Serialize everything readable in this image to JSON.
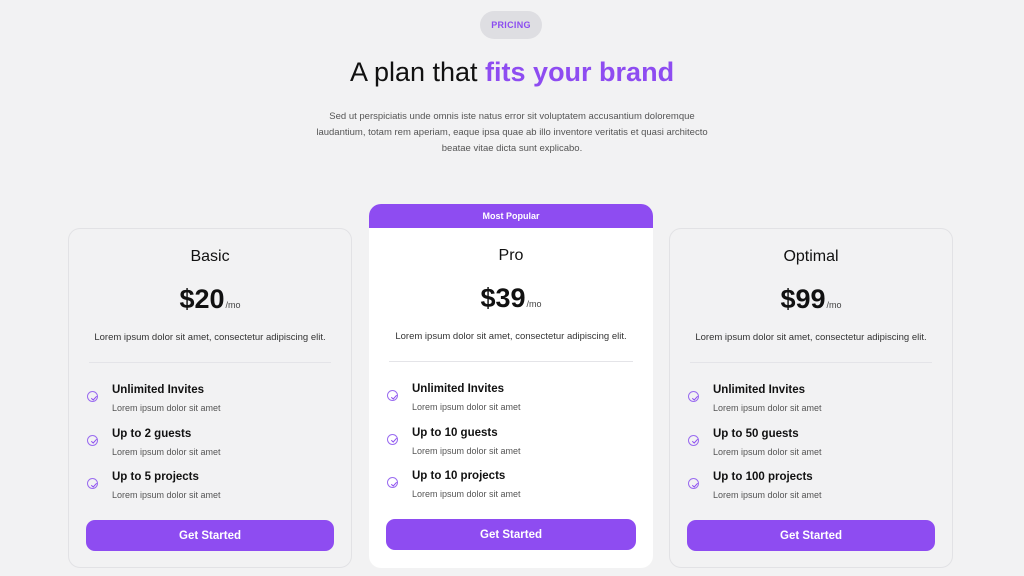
{
  "header": {
    "badge": "PRICING",
    "title_plain": "A plan that ",
    "title_accent": "fits your brand",
    "subtitle": "Sed ut perspiciatis unde omnis iste natus error sit voluptatem accusantium doloremque laudantium, totam rem aperiam, eaque ipsa quae ab illo inventore veritatis et quasi architecto beatae vitae dicta sunt explicabo."
  },
  "colors": {
    "accent": "#8e4cf1",
    "background": "#f2f2f3",
    "card_highlight": "#ffffff"
  },
  "plans": [
    {
      "name": "Basic",
      "price": "$20",
      "period": "/mo",
      "description": "Lorem ipsum dolor sit amet, consectetur adipiscing elit.",
      "features": [
        {
          "title": "Unlimited Invites",
          "subtitle": "Lorem ipsum dolor sit amet"
        },
        {
          "title": "Up to 2 guests",
          "subtitle": "Lorem ipsum dolor sit amet"
        },
        {
          "title": "Up to 5 projects",
          "subtitle": "Lorem ipsum dolor sit amet"
        }
      ],
      "cta": "Get Started"
    },
    {
      "name": "Pro",
      "banner": "Most Popular",
      "price": "$39",
      "period": "/mo",
      "description": "Lorem ipsum dolor sit amet, consectetur adipiscing elit.",
      "features": [
        {
          "title": "Unlimited Invites",
          "subtitle": "Lorem ipsum dolor sit amet"
        },
        {
          "title": "Up to 10 guests",
          "subtitle": "Lorem ipsum dolor sit amet"
        },
        {
          "title": "Up to 10 projects",
          "subtitle": "Lorem ipsum dolor sit amet"
        }
      ],
      "cta": "Get Started"
    },
    {
      "name": "Optimal",
      "price": "$99",
      "period": "/mo",
      "description": "Lorem ipsum dolor sit amet, consectetur adipiscing elit.",
      "features": [
        {
          "title": "Unlimited Invites",
          "subtitle": "Lorem ipsum dolor sit amet"
        },
        {
          "title": "Up to 50 guests",
          "subtitle": "Lorem ipsum dolor sit amet"
        },
        {
          "title": "Up to 100 projects",
          "subtitle": "Lorem ipsum dolor sit amet"
        }
      ],
      "cta": "Get Started"
    }
  ]
}
